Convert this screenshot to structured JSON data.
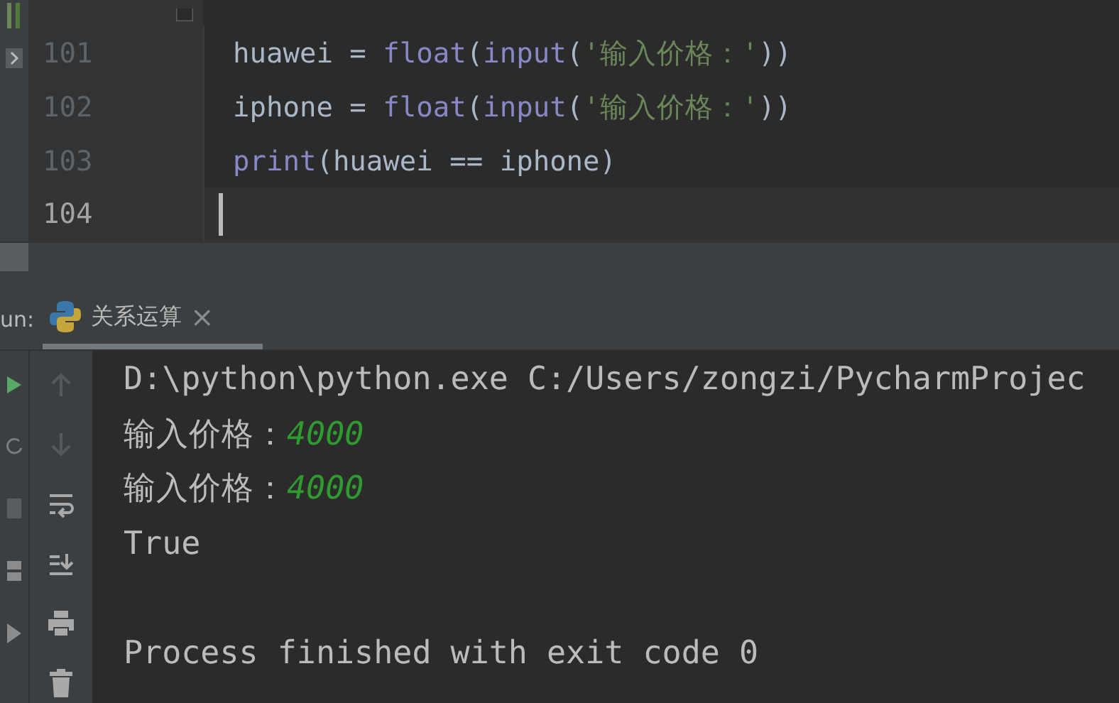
{
  "editor": {
    "lines": [
      {
        "number": "101",
        "current": false,
        "tokens": [
          {
            "text": "huawei = ",
            "kind": "plain"
          },
          {
            "text": "float",
            "kind": "builtin"
          },
          {
            "text": "(",
            "kind": "plain"
          },
          {
            "text": "input",
            "kind": "builtin"
          },
          {
            "text": "(",
            "kind": "plain"
          },
          {
            "text": "'输入价格：'",
            "kind": "string"
          },
          {
            "text": "))",
            "kind": "plain"
          }
        ]
      },
      {
        "number": "102",
        "current": false,
        "tokens": [
          {
            "text": "iphone = ",
            "kind": "plain"
          },
          {
            "text": "float",
            "kind": "builtin"
          },
          {
            "text": "(",
            "kind": "plain"
          },
          {
            "text": "input",
            "kind": "builtin"
          },
          {
            "text": "(",
            "kind": "plain"
          },
          {
            "text": "'输入价格：'",
            "kind": "string"
          },
          {
            "text": "))",
            "kind": "plain"
          }
        ]
      },
      {
        "number": "103",
        "current": false,
        "tokens": [
          {
            "text": "print",
            "kind": "builtin"
          },
          {
            "text": "(huawei == iphone)",
            "kind": "plain"
          }
        ]
      },
      {
        "number": "104",
        "current": true
      }
    ]
  },
  "run_panel": {
    "label": "un:",
    "tabs": [
      {
        "label": "关系运算",
        "close": "×",
        "selected": true
      }
    ],
    "console": [
      {
        "kind": "text",
        "segments": [
          {
            "text": "D:\\python\\python.exe C:/Users/zongzi/PycharmProjec",
            "kind": "output"
          }
        ]
      },
      {
        "kind": "text",
        "segments": [
          {
            "text": "输入价格：",
            "kind": "output"
          },
          {
            "text": "4000",
            "kind": "input"
          }
        ]
      },
      {
        "kind": "text",
        "segments": [
          {
            "text": "输入价格：",
            "kind": "output"
          },
          {
            "text": "4000",
            "kind": "input"
          }
        ]
      },
      {
        "kind": "text",
        "segments": [
          {
            "text": "True",
            "kind": "output"
          }
        ]
      },
      {
        "kind": "blank"
      },
      {
        "kind": "text",
        "segments": [
          {
            "text": "Process finished with exit code 0",
            "kind": "output"
          }
        ]
      }
    ]
  }
}
